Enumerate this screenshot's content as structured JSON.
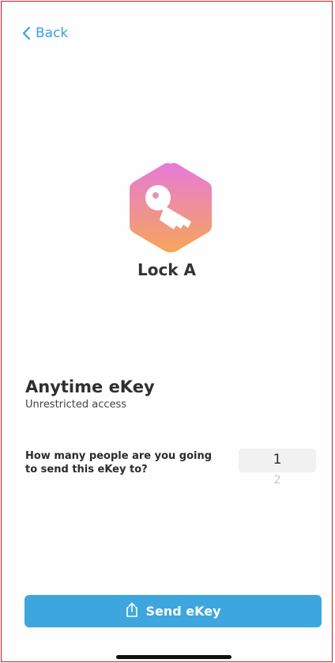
{
  "nav": {
    "back_label": "Back"
  },
  "lock": {
    "name": "Lock A"
  },
  "ekey": {
    "title": "Anytime eKey",
    "subtitle": "Unrestricted access"
  },
  "recipients": {
    "question": "How many people are you going to send this eKey to?",
    "options": [
      "1",
      "2"
    ],
    "selected": "1"
  },
  "actions": {
    "send_label": "Send eKey"
  },
  "colors": {
    "accent": "#3ea6de",
    "badge_gradient_top": "#e77ad8",
    "badge_gradient_bottom": "#f6a55a"
  },
  "icons": {
    "back": "chevron-left-icon",
    "badge": "key-icon",
    "send": "share-icon"
  }
}
